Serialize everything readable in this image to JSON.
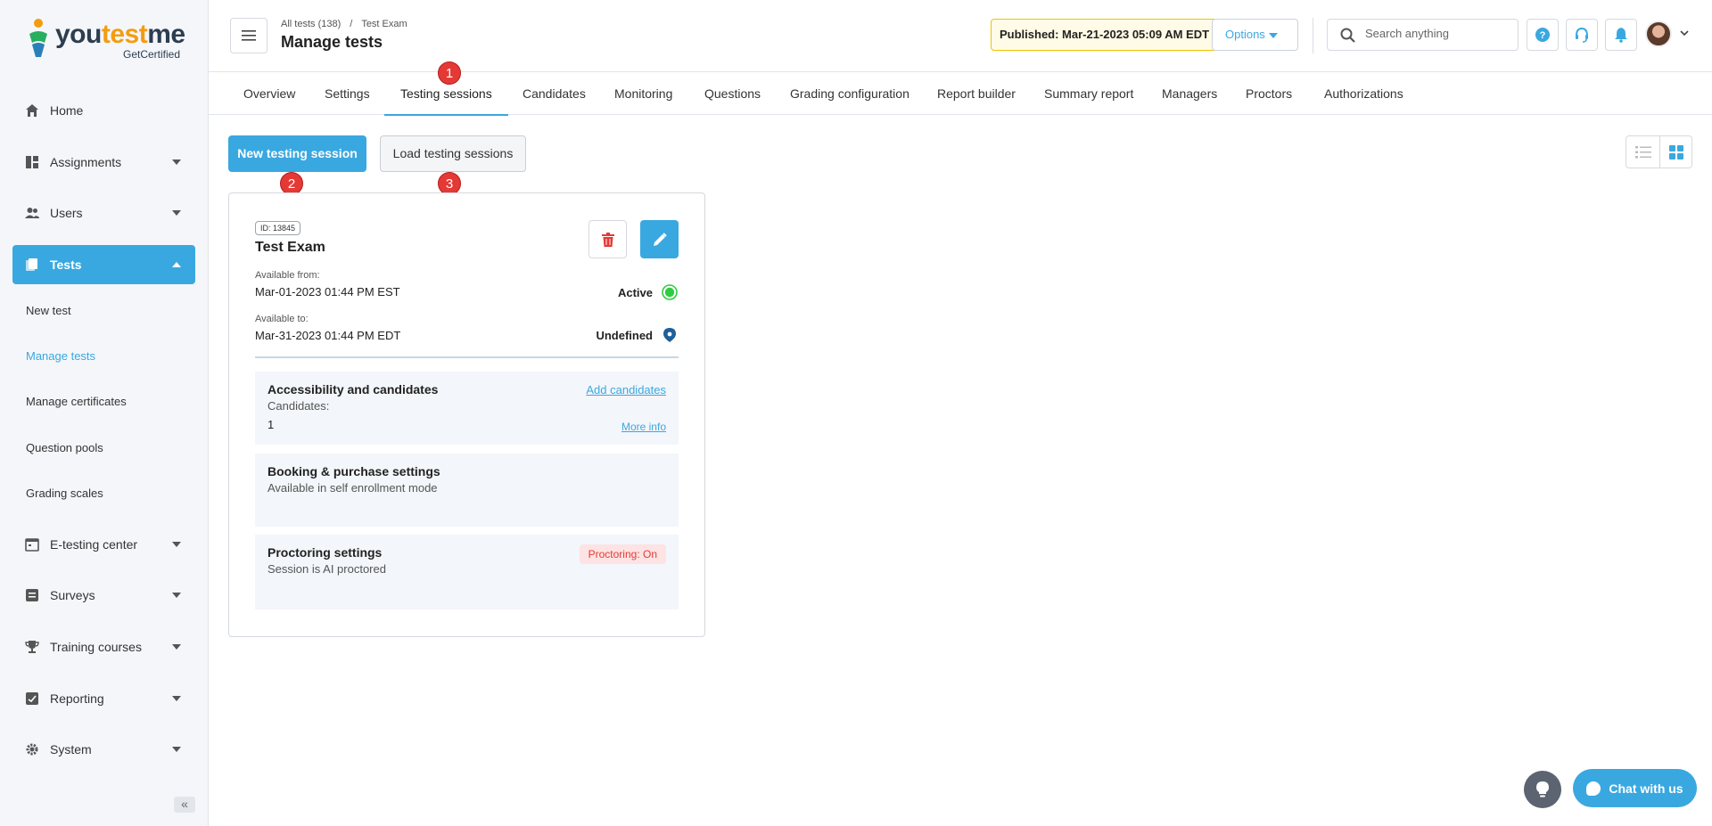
{
  "logo": {
    "brand_pre": "you",
    "brand_accent": "test",
    "brand_post": "me",
    "tagline": "GetCertified"
  },
  "sidebar": {
    "items": [
      {
        "label": "Home",
        "icon": "home-icon"
      },
      {
        "label": "Assignments",
        "icon": "dashboard-icon"
      },
      {
        "label": "Users",
        "icon": "users-icon"
      },
      {
        "label": "Tests",
        "icon": "tests-icon"
      },
      {
        "label": "E-testing center",
        "icon": "calendar-icon"
      },
      {
        "label": "Surveys",
        "icon": "list-icon"
      },
      {
        "label": "Training courses",
        "icon": "trophy-icon"
      },
      {
        "label": "Reporting",
        "icon": "report-icon"
      },
      {
        "label": "System",
        "icon": "gear-icon"
      }
    ],
    "sub_items": [
      "New test",
      "Manage tests",
      "Manage certificates",
      "Question pools",
      "Grading scales"
    ],
    "collapse": "«"
  },
  "header": {
    "breadcrumb": [
      "All tests (138)",
      "Test Exam"
    ],
    "breadcrumb_sep": "/",
    "title": "Manage tests",
    "published": "Published: Mar-21-2023 05:09 AM EDT",
    "options": "Options",
    "search_placeholder": "Search anything"
  },
  "tabs": [
    "Overview",
    "Settings",
    "Testing sessions",
    "Candidates",
    "Monitoring",
    "Questions",
    "Grading configuration",
    "Report builder",
    "Summary report",
    "Managers",
    "Proctors",
    "Authorizations"
  ],
  "badges": [
    "1",
    "2",
    "3"
  ],
  "actions": {
    "new_session": "New testing session",
    "load_sessions": "Load testing sessions"
  },
  "card": {
    "id": "ID: 13845",
    "title": "Test Exam",
    "available_from_label": "Available from:",
    "available_from": "Mar-01-2023 01:44 PM EST",
    "status_from": "Active",
    "available_to_label": "Available to:",
    "available_to": "Mar-31-2023 01:44 PM EDT",
    "status_to": "Undefined",
    "sections": {
      "accessibility": {
        "title": "Accessibility and candidates",
        "link": "Add candidates",
        "candidates_label": "Candidates:",
        "candidates_count": "1",
        "more": "More info"
      },
      "booking": {
        "title": "Booking & purchase settings",
        "sub": "Available in self enrollment mode"
      },
      "proctoring": {
        "title": "Proctoring settings",
        "sub": "Session is AI proctored",
        "pill": "Proctoring: On"
      }
    }
  },
  "chat": {
    "label": "Chat with us"
  },
  "colors": {
    "accent": "#3aa8e0",
    "badge": "#e53935",
    "active_status": "#2ecc40",
    "published_border": "#f0c300"
  }
}
